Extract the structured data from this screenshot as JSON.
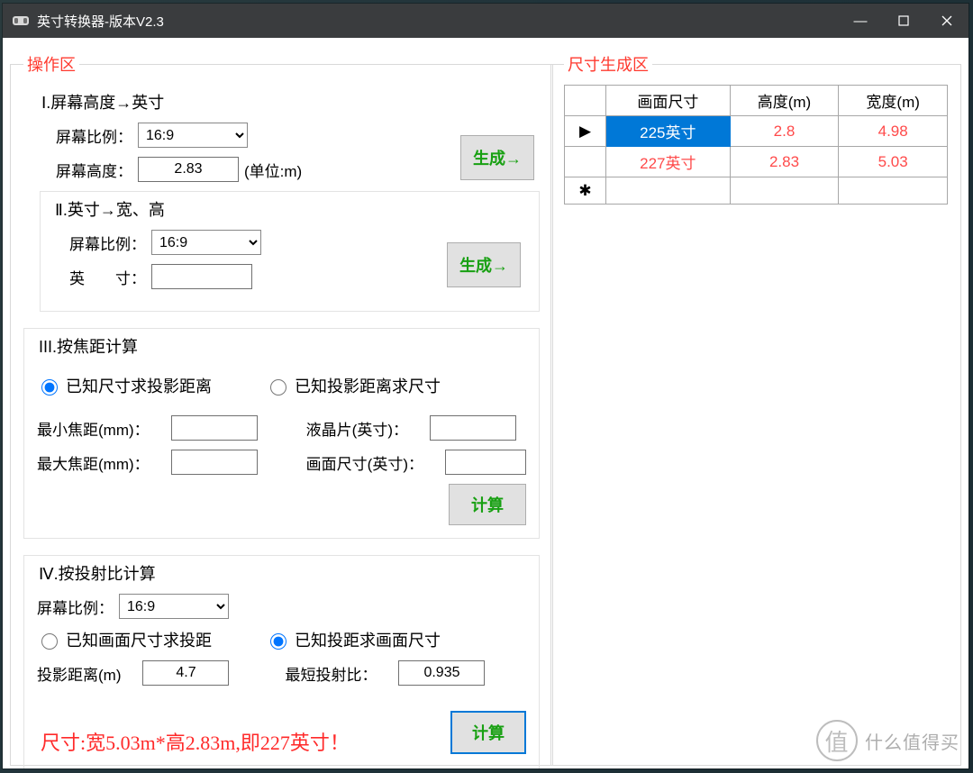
{
  "window": {
    "title": "英寸转换器-版本V2.3",
    "minimize": "—",
    "maximize": "□",
    "close": "✕"
  },
  "ops": {
    "legend": "操作区",
    "sec1": {
      "title": "Ⅰ.屏幕高度→英寸",
      "ratio_label": "屏幕比例：",
      "ratio_value": "16:9",
      "height_label": "屏幕高度：",
      "height_value": "2.83",
      "height_unit": "(单位:m)",
      "button": "生成→"
    },
    "sec2": {
      "title": "Ⅱ.英寸→宽、高",
      "ratio_label": "屏幕比例：",
      "ratio_value": "16:9",
      "inch_label": "英　　寸：",
      "inch_value": "",
      "button": "生成→"
    },
    "sec3": {
      "title": "III.按焦距计算",
      "radio_a": "已知尺寸求投影距离",
      "radio_b": "已知投影距离求尺寸",
      "min_focal_label": "最小焦距(mm)：",
      "min_focal_value": "",
      "max_focal_label": "最大焦距(mm)：",
      "max_focal_value": "",
      "lcd_label": "液晶片(英寸)：",
      "lcd_value": "",
      "screen_label": "画面尺寸(英寸)：",
      "screen_value": "",
      "button": "计算"
    },
    "sec4": {
      "title": "Ⅳ.按投射比计算",
      "ratio_label": "屏幕比例：",
      "ratio_value": "16:9",
      "radio_a": "已知画面尺寸求投距",
      "radio_b": "已知投距求画面尺寸",
      "dist_label": "投影距离(m)",
      "dist_value": "4.7",
      "throw_label": "最短投射比：",
      "throw_value": "0.935",
      "button": "计算",
      "result": "尺寸:宽5.03m*高2.83m,即227英寸！"
    }
  },
  "gen": {
    "legend": "尺寸生成区",
    "headers": {
      "size": "画面尺寸",
      "height": "高度(m)",
      "width": "宽度(m)"
    },
    "rows": [
      {
        "marker": "▶",
        "size": "225英寸",
        "height": "2.8",
        "width": "4.98",
        "selected": true
      },
      {
        "marker": "",
        "size": "227英寸",
        "height": "2.83",
        "width": "5.03",
        "selected": false
      }
    ],
    "new_marker": "✱"
  },
  "watermark": {
    "char": "值",
    "text": "什么值得买"
  }
}
